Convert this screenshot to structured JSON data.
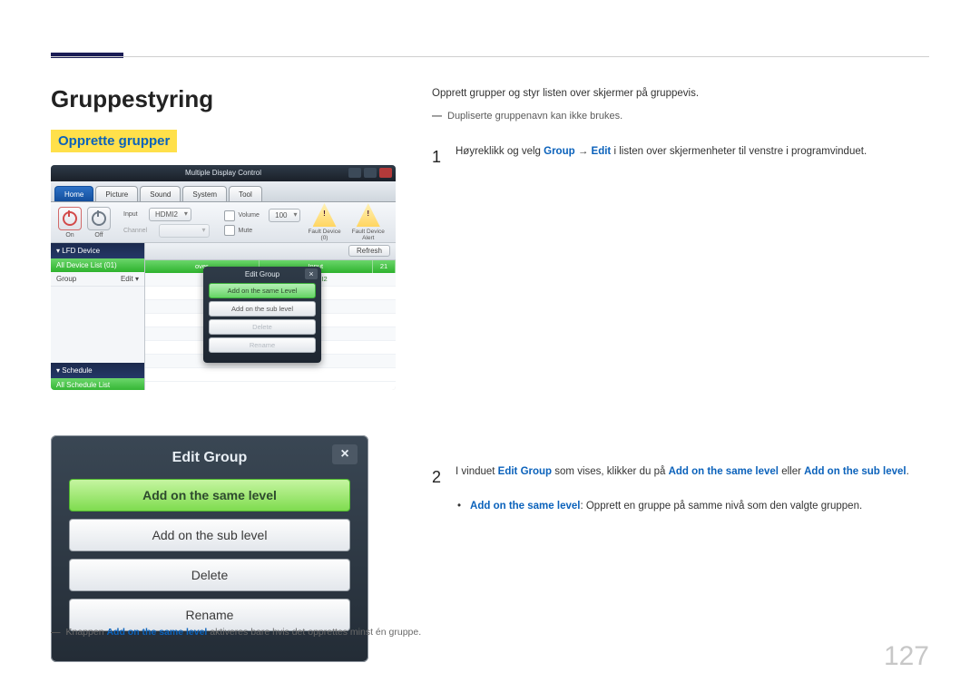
{
  "page_number": "127",
  "heading": "Gruppestyring",
  "subheading": "Opprette grupper",
  "intro": "Opprett grupper og styr listen over skjermer på gruppevis.",
  "note_top": "Dupliserte gruppenavn kan ikke brukes.",
  "step1": {
    "prefix": "Høyreklikk og velg ",
    "kw1": "Group",
    "arrow": " → ",
    "kw2": "Edit",
    "suffix": " i listen over skjermenheter til venstre i programvinduet."
  },
  "step2": {
    "prefix": "I vinduet ",
    "kw1": "Edit Group",
    "mid1": " som vises, klikker du på ",
    "kw2": "Add on the same level",
    "mid2": " eller ",
    "kw3": "Add on the sub level",
    "suffix": "."
  },
  "bullet": {
    "kw": "Add on the same level",
    "text": ": Opprett en gruppe på samme nivå som den valgte gruppen."
  },
  "footnote": {
    "prefix": "Knappen ",
    "kw": "Add on the same level",
    "suffix": " aktiveres bare hvis det opprettes minst én gruppe."
  },
  "mdc": {
    "title": "Multiple Display Control",
    "tabs": [
      "Home",
      "Picture",
      "Sound",
      "System",
      "Tool"
    ],
    "on_lbl": "On",
    "off_lbl": "Off",
    "input_lbl": "Input",
    "input_val": "HDMI2",
    "channel_lbl": "Channel",
    "vol_chk": "Volume",
    "vol_val": "100",
    "mute_chk": "Mute",
    "fault1": "Fault Device (0)",
    "fault2": "Fault Device Alert",
    "side_header": "▾ LFD Device",
    "side_all": "All Device List (01)",
    "side_group_l": "Group",
    "side_group_r": "Edit ▾",
    "side_sched_hdr": "▾ Schedule",
    "side_sched_all": "All Schedule List",
    "refresh": "Refresh",
    "grid_headers": [
      "",
      "",
      "over",
      "Input",
      ""
    ],
    "grid_row0": [
      "",
      "",
      "",
      "HDMI2",
      "21"
    ],
    "mini": {
      "title": "Edit Group",
      "btn_same": "Add on the same Level",
      "btn_sub": "Add on the sub level",
      "btn_del": "Delete",
      "btn_ren": "Rename"
    }
  },
  "dialog2": {
    "title": "Edit Group",
    "btn_same": "Add on the same level",
    "btn_sub": "Add on the sub level",
    "btn_del": "Delete",
    "btn_ren": "Rename"
  }
}
